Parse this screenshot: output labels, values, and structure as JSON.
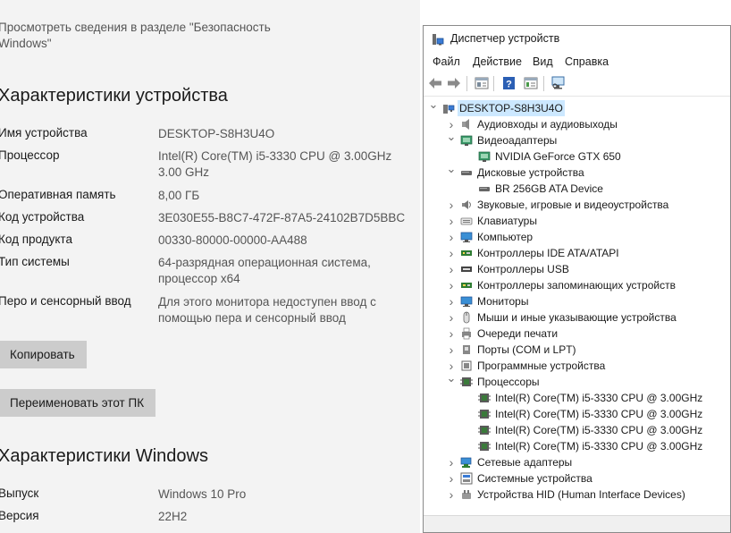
{
  "settings": {
    "security_link": "Просмотреть сведения в разделе \"Безопасность Windows\"",
    "device_heading": "Характеристики устройства",
    "device_rows": [
      {
        "label": "Имя устройства",
        "value": "DESKTOP-S8H3U4O"
      },
      {
        "label": "Процессор",
        "value": "Intel(R) Core(TM) i5-3330 CPU @ 3.00GHz 3.00 GHz"
      },
      {
        "label": "Оперативная память",
        "value": "8,00 ГБ"
      },
      {
        "label": "Код устройства",
        "value": "3E030E55-B8C7-472F-87A5-24102B7D5BBC"
      },
      {
        "label": "Код продукта",
        "value": "00330-80000-00000-AA488"
      },
      {
        "label": "Тип системы",
        "value": "64-разрядная операционная система, процессор x64"
      },
      {
        "label": "Перо и сенсорный ввод",
        "value": "Для этого монитора недоступен ввод с помощью пера и сенсорный ввод"
      }
    ],
    "copy_button": "Копировать",
    "rename_button": "Переименовать этот ПК",
    "windows_heading": "Характеристики Windows",
    "windows_rows": [
      {
        "label": "Выпуск",
        "value": "Windows 10 Pro"
      },
      {
        "label": "Версия",
        "value": "22H2"
      }
    ]
  },
  "device_manager": {
    "title": "Диспетчер устройств",
    "menu": [
      "Файл",
      "Действие",
      "Вид",
      "Справка"
    ],
    "toolbar_icons": [
      "back-arrow-icon",
      "forward-arrow-icon",
      "properties-icon",
      "help-icon",
      "view-icon",
      "monitor-scan-icon"
    ],
    "tree": [
      {
        "label": "DESKTOP-S8H3U4O",
        "level": 0,
        "expander": "open",
        "icon": "computer-root-icon",
        "selected": true
      },
      {
        "label": "Аудиовходы и аудиовыходы",
        "level": 1,
        "expander": "closed",
        "icon": "audio-icon"
      },
      {
        "label": "Видеоадаптеры",
        "level": 1,
        "expander": "open",
        "icon": "display-adapter-icon"
      },
      {
        "label": "NVIDIA GeForce GTX 650",
        "level": 2,
        "expander": "none",
        "icon": "display-adapter-icon"
      },
      {
        "label": "Дисковые устройства",
        "level": 1,
        "expander": "open",
        "icon": "disk-icon"
      },
      {
        "label": "BR 256GB ATA Device",
        "level": 2,
        "expander": "none",
        "icon": "disk-icon"
      },
      {
        "label": "Звуковые, игровые и видеоустройства",
        "level": 1,
        "expander": "closed",
        "icon": "sound-icon"
      },
      {
        "label": "Клавиатуры",
        "level": 1,
        "expander": "closed",
        "icon": "keyboard-icon"
      },
      {
        "label": "Компьютер",
        "level": 1,
        "expander": "closed",
        "icon": "monitor-icon"
      },
      {
        "label": "Контроллеры IDE ATA/ATAPI",
        "level": 1,
        "expander": "closed",
        "icon": "ide-controller-icon"
      },
      {
        "label": "Контроллеры USB",
        "level": 1,
        "expander": "closed",
        "icon": "usb-icon"
      },
      {
        "label": "Контроллеры запоминающих устройств",
        "level": 1,
        "expander": "closed",
        "icon": "storage-controller-icon"
      },
      {
        "label": "Мониторы",
        "level": 1,
        "expander": "closed",
        "icon": "monitor-icon"
      },
      {
        "label": "Мыши и иные указывающие устройства",
        "level": 1,
        "expander": "closed",
        "icon": "mouse-icon"
      },
      {
        "label": "Очереди печати",
        "level": 1,
        "expander": "closed",
        "icon": "printer-icon"
      },
      {
        "label": "Порты (COM и LPT)",
        "level": 1,
        "expander": "closed",
        "icon": "port-icon"
      },
      {
        "label": "Программные устройства",
        "level": 1,
        "expander": "closed",
        "icon": "software-device-icon"
      },
      {
        "label": "Процессоры",
        "level": 1,
        "expander": "open",
        "icon": "cpu-icon"
      },
      {
        "label": "Intel(R) Core(TM) i5-3330 CPU @ 3.00GHz",
        "level": 2,
        "expander": "none",
        "icon": "cpu-icon"
      },
      {
        "label": "Intel(R) Core(TM) i5-3330 CPU @ 3.00GHz",
        "level": 2,
        "expander": "none",
        "icon": "cpu-icon"
      },
      {
        "label": "Intel(R) Core(TM) i5-3330 CPU @ 3.00GHz",
        "level": 2,
        "expander": "none",
        "icon": "cpu-icon"
      },
      {
        "label": "Intel(R) Core(TM) i5-3330 CPU @ 3.00GHz",
        "level": 2,
        "expander": "none",
        "icon": "cpu-icon"
      },
      {
        "label": "Сетевые адаптеры",
        "level": 1,
        "expander": "closed",
        "icon": "network-icon"
      },
      {
        "label": "Системные устройства",
        "level": 1,
        "expander": "closed",
        "icon": "system-device-icon"
      },
      {
        "label": "Устройства HID (Human Interface Devices)",
        "level": 1,
        "expander": "closed",
        "icon": "hid-icon"
      }
    ]
  }
}
